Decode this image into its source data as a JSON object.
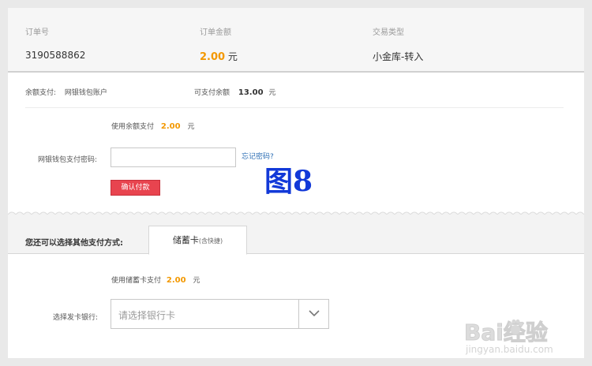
{
  "order": {
    "id_label": "订单号",
    "id_value": "3190588862",
    "amount_label": "订单金额",
    "amount_value": "2.00",
    "amount_unit": "元",
    "type_label": "交易类型",
    "type_value": "小金库-转入"
  },
  "balance_pay": {
    "label": "余额支付:",
    "account": "网银钱包账户",
    "available_label": "可支付余额",
    "available_value": "13.00",
    "available_unit": "元",
    "use_label": "使用余额支付",
    "use_value": "2.00",
    "use_unit": "元",
    "password_label": "网银钱包支付密码:",
    "password_value": "",
    "forgot_link": "忘记密码?",
    "confirm_button": "确认付款"
  },
  "figure_label": "图8",
  "other_pay": {
    "label": "您还可以选择其他支付方式:",
    "tab_main": "储蓄卡",
    "tab_sub": "(含快捷)",
    "use_label": "使用储蓄卡支付",
    "use_value": "2.00",
    "use_unit": "元",
    "bank_label": "选择发卡银行:",
    "bank_placeholder": "请选择银行卡"
  },
  "watermark": {
    "brand": "Bai经验",
    "url": "jingyan.baidu.com"
  },
  "icons": {
    "select_arrow": "chevron-down-icon",
    "watermark_paw": "baidu-paw-icon"
  },
  "colors": {
    "accent_orange": "#f39800",
    "confirm_red": "#e8444f",
    "link_blue": "#2d6fb5",
    "figure_blue": "#1239d8"
  }
}
